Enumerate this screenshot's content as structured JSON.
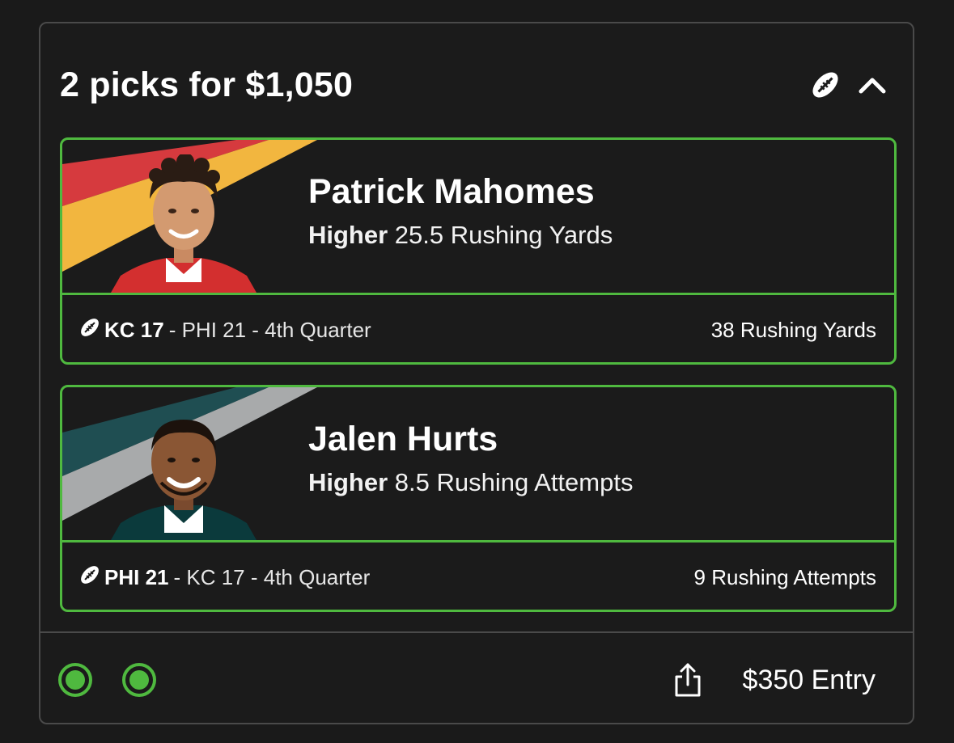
{
  "header": {
    "title": "2 picks for $1,050",
    "sport_icon": "football-icon",
    "collapse_icon": "chevron-up-icon"
  },
  "picks": [
    {
      "player_name": "Patrick Mahomes",
      "direction": "Higher",
      "line_text": " 25.5 Rushing Yards",
      "team_score": "KC 17",
      "game_rest": "- PHI 21 - 4th Quarter",
      "stat_result": "38 Rushing Yards",
      "team_colors": [
        "#d63a3e",
        "#f2b63f"
      ],
      "jersey_color": "#d32f2f"
    },
    {
      "player_name": "Jalen Hurts",
      "direction": "Higher",
      "line_text": " 8.5 Rushing Attempts",
      "team_score": "PHI 21",
      "game_rest": "- KC 17 - 4th Quarter",
      "stat_result": "9 Rushing Attempts",
      "team_colors": [
        "#1f4e52",
        "#a8aaab"
      ],
      "jersey_color": "#0b3a3c"
    }
  ],
  "footer": {
    "results": [
      "win",
      "win"
    ],
    "share_icon": "share-icon",
    "entry_text": "$350 Entry"
  },
  "colors": {
    "accent_green": "#4fb93f",
    "background": "#1a1a1a",
    "border_gray": "#4a4a4a"
  }
}
